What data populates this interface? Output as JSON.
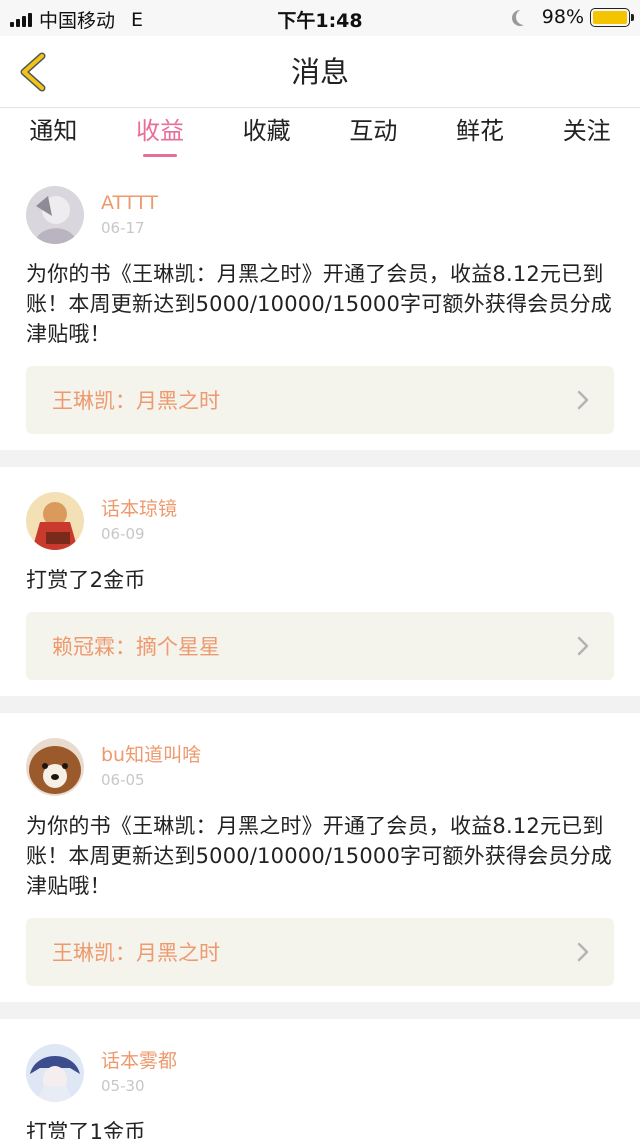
{
  "status_bar": {
    "carrier": "中国移动",
    "network": "E",
    "time": "下午1:48",
    "battery": "98%"
  },
  "nav": {
    "title": "消息"
  },
  "tabs": [
    {
      "label": "通知",
      "active": false
    },
    {
      "label": "收益",
      "active": true
    },
    {
      "label": "收藏",
      "active": false
    },
    {
      "label": "互动",
      "active": false
    },
    {
      "label": "鲜花",
      "active": false
    },
    {
      "label": "关注",
      "active": false
    }
  ],
  "messages": [
    {
      "username": "ATTTT",
      "date": "06-17",
      "text": "为你的书《王琳凯：月黑之时》开通了会员，收益8.12元已到账！本周更新达到5000/10000/15000字可额外获得会员分成津贴哦！",
      "book": "王琳凯：月黑之时"
    },
    {
      "username": "话本琼镜",
      "date": "06-09",
      "text": "打赏了2金币",
      "book": "赖冠霖：摘个星星"
    },
    {
      "username": "bu知道叫啥",
      "date": "06-05",
      "text": "为你的书《王琳凯：月黑之时》开通了会员，收益8.12元已到账！本周更新达到5000/10000/15000字可额外获得会员分成津贴哦！",
      "book": "王琳凯：月黑之时"
    },
    {
      "username": "话本雾都",
      "date": "05-30",
      "text": "打赏了1金币",
      "book": ""
    }
  ],
  "colors": {
    "accent_pink": "#e86e9a",
    "username_orange": "#ee9a6f",
    "back_arrow_yellow": "#f0c419",
    "book_link_bg": "#f4f3ec"
  }
}
